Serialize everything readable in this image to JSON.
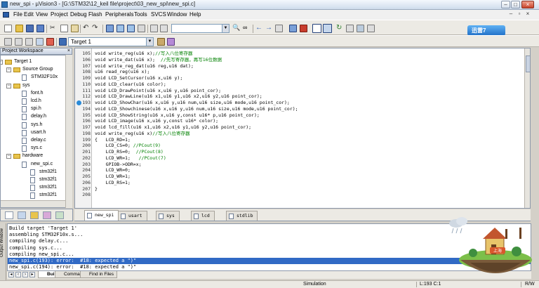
{
  "window": {
    "title": "new_spi - µVision3 - [G:\\STM32\\12_keil file\\project\\03_new_spi\\new_spi.c]"
  },
  "menu": [
    "File",
    "Edit",
    "View",
    "Project",
    "Debug",
    "Flash",
    "Peripherals",
    "Tools",
    "SVCS",
    "Window",
    "Help"
  ],
  "toolbar": {
    "target_select": "Target 1",
    "xunlei_label": "迅雷7"
  },
  "workspace": {
    "title": "Project Workspace",
    "tree": [
      {
        "label": "Target 1",
        "depth": 0,
        "kind": "target"
      },
      {
        "label": "Source Group",
        "depth": 1,
        "kind": "folder"
      },
      {
        "label": "STM32F10x",
        "depth": 2,
        "kind": "file"
      },
      {
        "label": "sys",
        "depth": 1,
        "kind": "folder"
      },
      {
        "label": "font.h",
        "depth": 2,
        "kind": "file"
      },
      {
        "label": "lcd.h",
        "depth": 2,
        "kind": "file"
      },
      {
        "label": "spi.h",
        "depth": 2,
        "kind": "file"
      },
      {
        "label": "delay.h",
        "depth": 2,
        "kind": "file"
      },
      {
        "label": "sys.h",
        "depth": 2,
        "kind": "file"
      },
      {
        "label": "usart.h",
        "depth": 2,
        "kind": "file"
      },
      {
        "label": "delay.c",
        "depth": 2,
        "kind": "file"
      },
      {
        "label": "sys.c",
        "depth": 2,
        "kind": "file"
      },
      {
        "label": "hardware",
        "depth": 1,
        "kind": "folder"
      },
      {
        "label": "new_spi.c",
        "depth": 2,
        "kind": "file"
      },
      {
        "label": "stm32f1",
        "depth": 3,
        "kind": "file"
      },
      {
        "label": "stm32f1",
        "depth": 3,
        "kind": "file"
      },
      {
        "label": "stm32f1",
        "depth": 3,
        "kind": "file"
      },
      {
        "label": "stm32f1",
        "depth": 3,
        "kind": "file"
      },
      {
        "label": "core_cm",
        "depth": 3,
        "kind": "file"
      }
    ]
  },
  "editor": {
    "lines": [
      {
        "num": "105",
        "code": "void write_reg(u16 x);",
        "comment": "//写入八位寄存器"
      },
      {
        "num": "106",
        "code": "void write_dat(u16 x);  ",
        "comment": "//先写寄存器，再写16位数据"
      },
      {
        "num": "107",
        "code": "void write_reg_dat(u16 reg,u16 dat);",
        "comment": ""
      },
      {
        "num": "108",
        "code": "u16 read_reg(u16 x);",
        "comment": ""
      },
      {
        "num": "109",
        "code": "void LCD_SetCursor(u16 x,u16 y);",
        "comment": ""
      },
      {
        "num": "110",
        "code": "void LCD_clear(u16 color);",
        "comment": ""
      },
      {
        "num": "111",
        "code": "void LCD_DrawPoint(u16 x,u16 y,u16 point_cor);",
        "comment": ""
      },
      {
        "num": "112",
        "code": "void LCD_DrawLine(u16 x1,u16 y1,u16 x2,u16 y2,u16 point_cor);",
        "comment": ""
      },
      {
        "num": "193",
        "code": "void LCD_ShowChar(u16 x,u16 y,u16 num,u16 size,u16 mode,u16 point_cor);",
        "comment": ""
      },
      {
        "num": "194",
        "code": "void LCD_Showchinese(u16 x,u16 y,u16 num,u16 size,u16 mode,u16 point_cor);",
        "comment": ""
      },
      {
        "num": "195",
        "code": "void LCD_ShowString(u16 x,u16 y,const u16* p,u16 point_cor);",
        "comment": ""
      },
      {
        "num": "196",
        "code": "void LCD_image(u16 x,u16 y,const u16* color);",
        "comment": ""
      },
      {
        "num": "197",
        "code": "void lcd_fill(u16 x1,u16 x2,u16 y1,u16 y2,u16 point_cor);",
        "comment": ""
      },
      {
        "num": "198",
        "code": "void write_reg(u16 x)",
        "comment": "//写入八位寄存器"
      },
      {
        "num": "199",
        "code": "{   LCD_RD=1;",
        "comment": ""
      },
      {
        "num": "200",
        "code": "    LCD_CS=0; ",
        "comment": "//PCout(9)"
      },
      {
        "num": "201",
        "code": "    LCD_RS=0;  ",
        "comment": "//PCout(8)"
      },
      {
        "num": "202",
        "code": "    LCD_WR=1;   ",
        "comment": "//PCout(7)"
      },
      {
        "num": "203",
        "code": "    GPIOB->ODR=x;",
        "comment": ""
      },
      {
        "num": "204",
        "code": "    LCD_WR=0;",
        "comment": ""
      },
      {
        "num": "205",
        "code": "    LCD_WR=1;",
        "comment": ""
      },
      {
        "num": "206",
        "code": "    LCD_RS=1;",
        "comment": ""
      },
      {
        "num": "207",
        "code": "}",
        "comment": ""
      },
      {
        "num": "208",
        "code": "",
        "comment": ""
      }
    ],
    "tabs": [
      "new_spi",
      "usart",
      "sys",
      "lcd",
      "stdlib"
    ]
  },
  "output": {
    "side_label": "Output Window",
    "lines": [
      "Build target 'Target 1'",
      "assembling STM32F10x.s...",
      "compiling delay.c...",
      "compiling sys.c...",
      "compiling new_spi.c...",
      "new_spi.c(193): error:  #18: expected a \")\"",
      "new_spi.c(194): error:  #18: expected a \")\""
    ],
    "selected_index": 5,
    "tabs": [
      "Build",
      "Command",
      "Find in Files"
    ]
  },
  "status": {
    "mode": "Simulation",
    "position": "L:193 C:1",
    "rw": "R/W"
  },
  "widget": {
    "city_label": "上海"
  },
  "colors": {
    "selection": "#316ac5",
    "comment": "#008000",
    "title_gradient_top": "#f4f8fd"
  }
}
